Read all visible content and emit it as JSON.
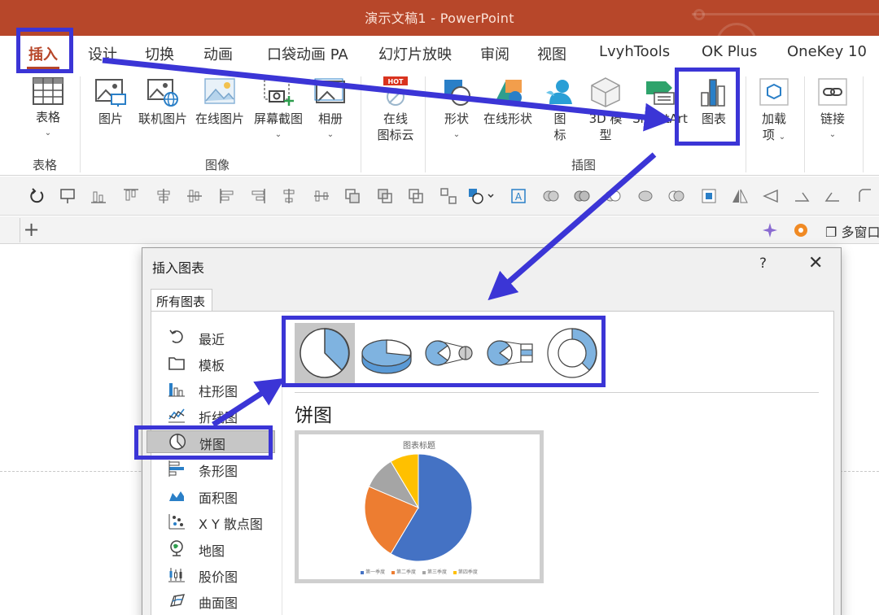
{
  "window": {
    "title": "演示文稿1 - PowerPoint"
  },
  "tabs": [
    "插入",
    "设计",
    "切换",
    "动画",
    "口袋动画 PA",
    "幻灯片放映",
    "审阅",
    "视图",
    "LvyhTools",
    "OK Plus",
    "OneKey 10"
  ],
  "ribbon": {
    "table": "表格",
    "picture": "图片",
    "online_pic": "联机图片",
    "online_pic2": "在线图片",
    "screenshot": "屏幕截图",
    "album": "相册",
    "icon_cloud_1": "在线",
    "icon_cloud_2": "图标云",
    "hot": "HOT",
    "shapes": "形状",
    "online_shapes": "在线形状",
    "icons_1": "图",
    "icons_2": "标",
    "model_1": "3D 模",
    "model_2": "型",
    "smartart": "SmartArt",
    "chart": "图表",
    "addin_1": "加载",
    "addin_2": "项",
    "link": "链接",
    "groups": {
      "table": "表格",
      "images": "图像",
      "illustrations": "插图"
    }
  },
  "slidebar": {
    "multiwindow": "多窗口"
  },
  "dialog": {
    "title": "插入图表",
    "help": "?",
    "tab": "所有图表",
    "categories": [
      "最近",
      "模板",
      "柱形图",
      "折线图",
      "饼图",
      "条形图",
      "面积图",
      "X Y 散点图",
      "地图",
      "股价图",
      "曲面图"
    ],
    "selected_heading": "饼图",
    "preview_title": "图表标题",
    "legend": [
      "第一季度",
      "第二季度",
      "第三季度",
      "第四季度"
    ]
  },
  "colors": {
    "brand": "#b7472a",
    "highlight": "#3b35d6",
    "series": [
      "#4472c4",
      "#ed7d31",
      "#a5a5a5",
      "#ffc000"
    ]
  },
  "chart_data": {
    "type": "pie",
    "title": "图表标题",
    "categories": [
      "第一季度",
      "第二季度",
      "第三季度",
      "第四季度"
    ],
    "values": [
      8.2,
      3.2,
      1.4,
      1.2
    ]
  }
}
